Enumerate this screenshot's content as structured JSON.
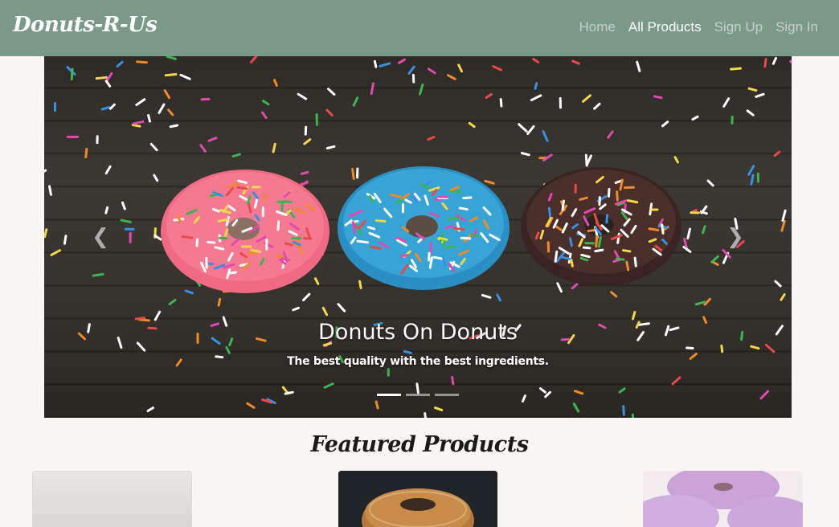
{
  "navbar": {
    "brand": "Donuts-R-Us",
    "links": [
      {
        "label": "Home",
        "active": false
      },
      {
        "label": "All Products",
        "active": true
      },
      {
        "label": "Sign Up",
        "active": false
      },
      {
        "label": "Sign In",
        "active": false
      }
    ]
  },
  "carousel": {
    "prev_icon": "chevron-left-icon",
    "next_icon": "chevron-right-icon",
    "caption_title": "Donuts On Donuts",
    "caption_text": "The best quality with the best ingredients.",
    "slide_count": 3,
    "active_slide": 1
  },
  "featured": {
    "title": "Featured Products"
  },
  "colors": {
    "navbar": "#7b9989",
    "background": "#f9f6f3"
  }
}
